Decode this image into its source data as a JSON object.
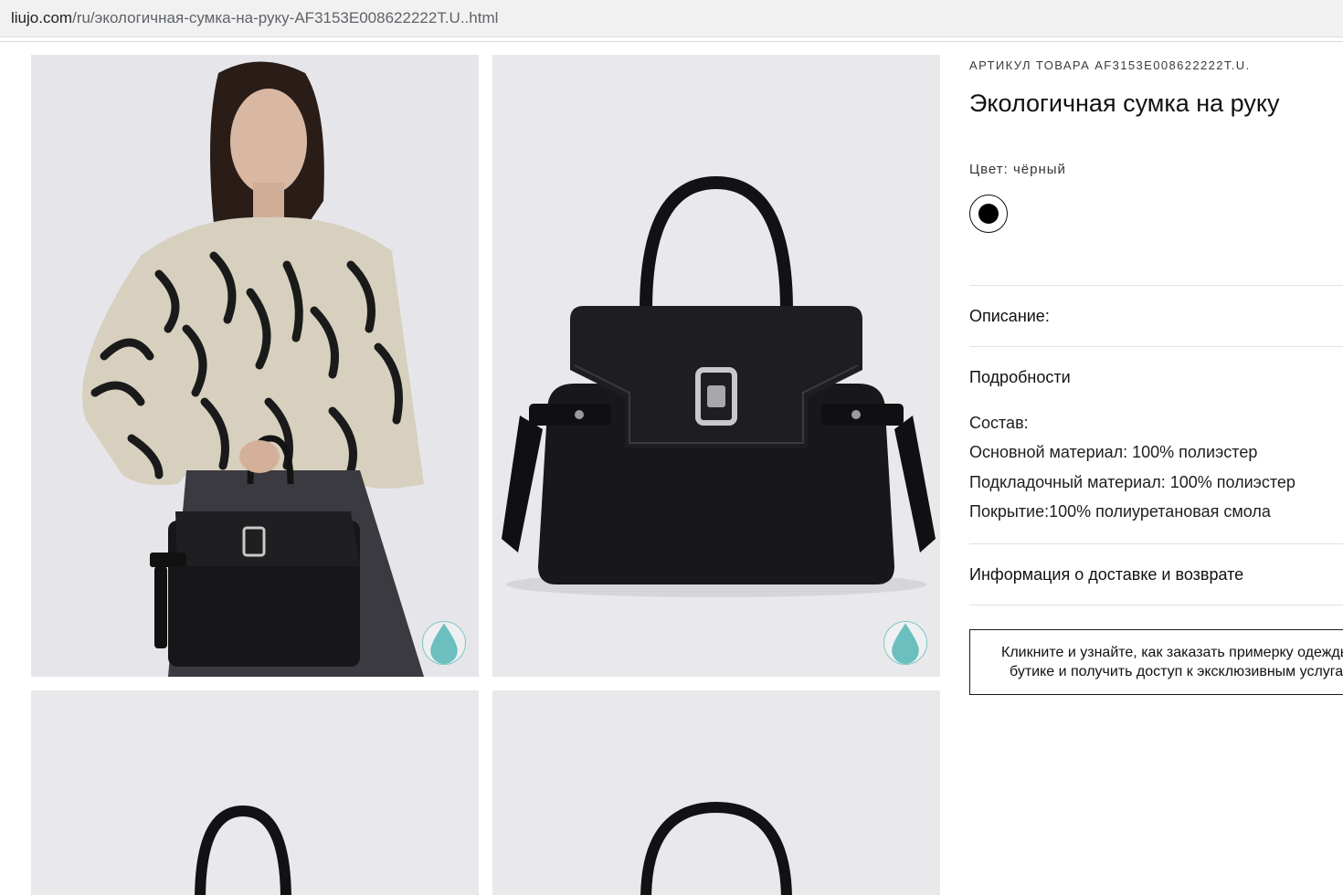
{
  "browser": {
    "url_domain": "liujo.com",
    "url_path": "/ru/экологичная-сумка-на-руку-AF3153E008622222T.U..html"
  },
  "gallery": {
    "images": [
      {
        "alt": "model-with-bag"
      },
      {
        "alt": "bag-front"
      },
      {
        "alt": "bag-view-3"
      },
      {
        "alt": "bag-view-4"
      }
    ],
    "eco_icon": "water-drop-icon"
  },
  "product": {
    "sku_label": "АРТИКУЛ ТОВАРА AF3153E008622222T.U.",
    "title": "Экологичная сумка на руку",
    "color_label": "Цвет: чёрный",
    "color_swatch": "#000000"
  },
  "accordion": {
    "description_label": "Описание:",
    "details_label": "Подробности",
    "details_lines": [
      "Состав:",
      "Основной материал: 100% полиэстер",
      "Подкладочный материал: 100% полиэстер",
      "Покрытие:100% полиуретановая смола"
    ],
    "shipping_label": "Информация о доставке и возврате"
  },
  "promo": {
    "line1": "Кликните и узнайте, как заказать примерку одежды в",
    "line2": "бутике и получить доступ к эксклюзивным услугам"
  },
  "colors": {
    "tile_bg": "#e9e9ec",
    "bag": "#17171a",
    "eco_accent": "#7fc6c6",
    "divider": "#e1e1e1"
  }
}
